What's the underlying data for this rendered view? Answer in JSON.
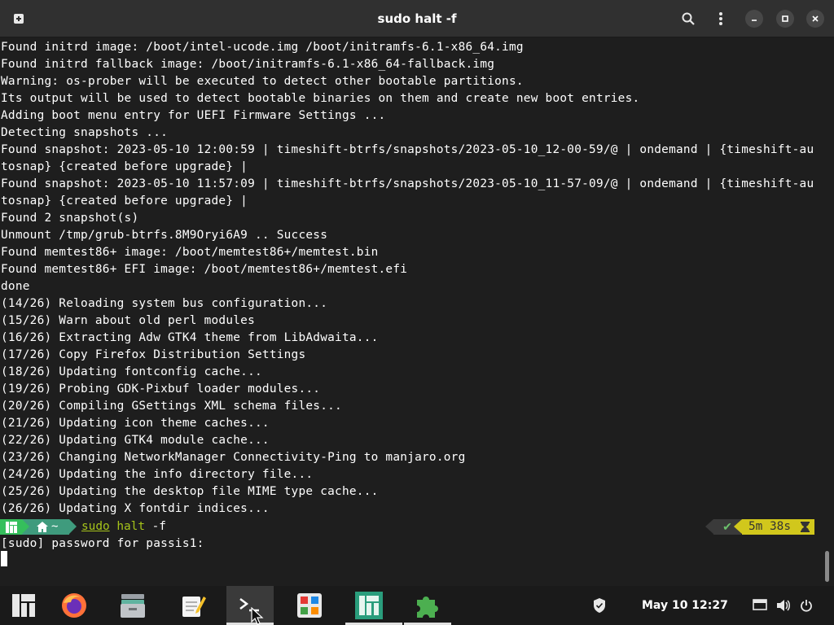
{
  "window": {
    "title": "sudo halt -f",
    "icons": [
      "new-tab-icon",
      "search-icon",
      "kebab-menu-icon",
      "minimize-icon",
      "maximize-icon",
      "close-icon"
    ]
  },
  "terminal": {
    "lines": [
      "Found initrd image: /boot/intel-ucode.img /boot/initramfs-6.1-x86_64.img",
      "Found initrd fallback image: /boot/initramfs-6.1-x86_64-fallback.img",
      "Warning: os-prober will be executed to detect other bootable partitions.",
      "Its output will be used to detect bootable binaries on them and create new boot entries.",
      "Adding boot menu entry for UEFI Firmware Settings ...",
      "Detecting snapshots ...",
      "Found snapshot: 2023-05-10 12:00:59 | timeshift-btrfs/snapshots/2023-05-10_12-00-59/@ | ondemand | {timeshift-au",
      "tosnap} {created before upgrade} |",
      "Found snapshot: 2023-05-10 11:57:09 | timeshift-btrfs/snapshots/2023-05-10_11-57-09/@ | ondemand | {timeshift-au",
      "tosnap} {created before upgrade} |",
      "Found 2 snapshot(s)",
      "Unmount /tmp/grub-btrfs.8M9Oryi6A9 .. Success",
      "Found memtest86+ image: /boot/memtest86+/memtest.bin",
      "Found memtest86+ EFI image: /boot/memtest86+/memtest.efi",
      "done",
      "(14/26) Reloading system bus configuration...",
      "(15/26) Warn about old perl modules",
      "(16/26) Extracting Adw GTK4 theme from LibAdwaita...",
      "(17/26) Copy Firefox Distribution Settings",
      "(18/26) Updating fontconfig cache...",
      "(19/26) Probing GDK-Pixbuf loader modules...",
      "(20/26) Compiling GSettings XML schema files...",
      "(21/26) Updating icon theme caches...",
      "(22/26) Updating GTK4 module cache...",
      "(23/26) Changing NetworkManager Connectivity-Ping to manjaro.org",
      "(24/26) Updating the info directory file...",
      "(25/26) Updating the desktop file MIME type cache...",
      "(26/26) Updating X fontdir indices..."
    ],
    "prompt": {
      "home": "~",
      "cmd_sudo": "sudo",
      "cmd_halt": "halt",
      "cmd_args": " -f",
      "status_check": "✔",
      "elapsed": "5m 38s"
    },
    "password_prompt": "[sudo] password for passis1:"
  },
  "taskbar": {
    "apps": [
      "manjaro-menu-icon",
      "firefox-icon",
      "file-manager-icon",
      "text-editor-icon",
      "terminal-icon",
      "software-store-icon",
      "manjaro-settings-icon",
      "extensions-icon"
    ],
    "clock": "May 10  12:27",
    "tray": [
      "shield-icon",
      "screen-icon",
      "volume-icon",
      "power-icon"
    ]
  },
  "colors": {
    "accent_green": "#35bf5c",
    "prompt_teal": "#3f9b7d",
    "command_green": "#a6c41a",
    "timer_yellow": "#d1c71c"
  }
}
